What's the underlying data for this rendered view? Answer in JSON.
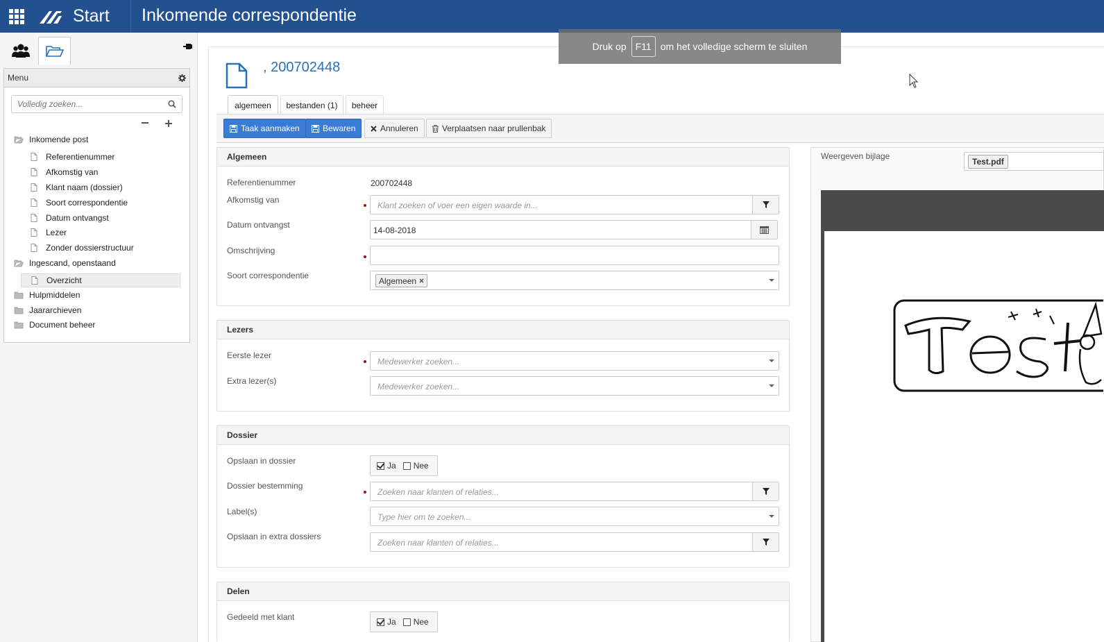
{
  "topbar": {
    "start_label": "Start",
    "page_title": "Inkomende correspondentie"
  },
  "overlay": {
    "prefix": "Druk op",
    "key": "F11",
    "suffix": "om het volledige scherm te sluiten"
  },
  "left_panel": {
    "menu_title": "Menu",
    "search_placeholder": "Volledig zoeken...",
    "tree": [
      {
        "label": "Inkomende post",
        "type": "folder-open"
      },
      {
        "label": "Referentienummer",
        "type": "doc"
      },
      {
        "label": "Afkomstig van",
        "type": "doc"
      },
      {
        "label": "Klant naam (dossier)",
        "type": "doc"
      },
      {
        "label": "Soort correspondentie",
        "type": "doc"
      },
      {
        "label": "Datum ontvangst",
        "type": "doc"
      },
      {
        "label": "Lezer",
        "type": "doc"
      },
      {
        "label": "Zonder dossierstructuur",
        "type": "doc"
      },
      {
        "label": "Ingescand, openstaand",
        "type": "folder-open"
      },
      {
        "label": "Overzicht",
        "type": "doc"
      },
      {
        "label": "Hulpmiddelen",
        "type": "folder"
      },
      {
        "label": "Jaararchieven",
        "type": "folder"
      },
      {
        "label": "Document beheer",
        "type": "folder"
      }
    ]
  },
  "document": {
    "title": ", 200702448"
  },
  "tabs": [
    "algemeen",
    "bestanden (1)",
    "beheer"
  ],
  "toolbar": {
    "create_task": "Taak aanmaken",
    "save": "Bewaren",
    "cancel": "Annuleren",
    "trash": "Verplaatsen naar prullenbak"
  },
  "algemeen": {
    "heading": "Algemeen",
    "ref_label": "Referentienummer",
    "ref_value": "200702448",
    "from_label": "Afkomstig van",
    "from_placeholder": "Klant zoeken of voer een eigen waarde in...",
    "date_label": "Datum ontvangst",
    "date_value": "14-08-2018",
    "desc_label": "Omschrijving",
    "desc_value": "",
    "type_label": "Soort correspondentie",
    "type_tag": "Algemeen"
  },
  "lezers": {
    "heading": "Lezers",
    "first_label": "Eerste lezer",
    "first_placeholder": "Medewerker zoeken...",
    "extra_label": "Extra lezer(s)",
    "extra_placeholder": "Medewerker zoeken..."
  },
  "dossier": {
    "heading": "Dossier",
    "save_label": "Opslaan in dossier",
    "yes": "Ja",
    "no": "Nee",
    "dest_label": "Dossier bestemming",
    "dest_placeholder": "Zoeken naar klanten of relaties...",
    "labels_label": "Label(s)",
    "labels_placeholder": "Type hier om te zoeken...",
    "extra_label": "Opslaan in extra dossiers",
    "extra_placeholder": "Zoeken naar klanten of relaties..."
  },
  "delen": {
    "heading": "Delen",
    "shared_label": "Gedeeld met klant",
    "yes": "Ja",
    "no": "Nee"
  },
  "preview": {
    "label": "Weergeven bijlage",
    "file": "Test.pdf"
  }
}
